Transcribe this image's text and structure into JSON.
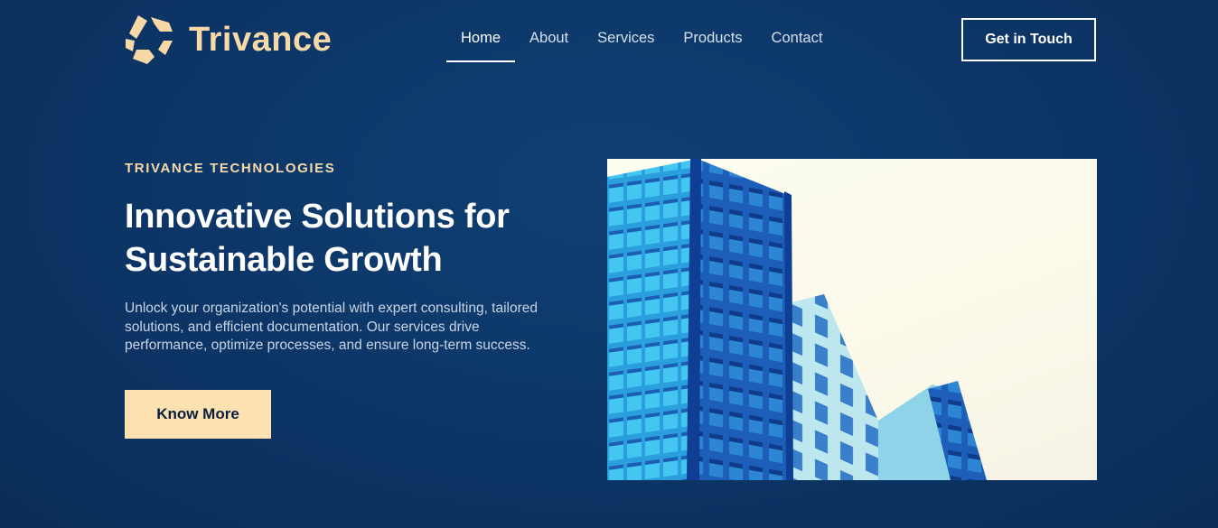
{
  "brand": {
    "name": "Trivance",
    "logo_icon": "trivance-logo-icon",
    "color": "#f7d9a8"
  },
  "nav": {
    "items": [
      {
        "label": "Home",
        "active": true
      },
      {
        "label": "About",
        "active": false
      },
      {
        "label": "Services",
        "active": false
      },
      {
        "label": "Products",
        "active": false
      },
      {
        "label": "Contact",
        "active": false
      }
    ],
    "cta_label": "Get in Touch"
  },
  "hero": {
    "eyebrow": "TRIVANCE TECHNOLOGIES",
    "headline_line1": "Innovative Solutions for",
    "headline_line2": "Sustainable Growth",
    "description": "Unlock your organization's potential with expert consulting, tailored solutions, and efficient documentation. Our services drive performance, optimize processes, and ensure long-term success.",
    "button_label": "Know More",
    "image_subject": "glass-office-building-photo"
  },
  "colors": {
    "background": "#0c3566",
    "accent": "#fde1b0",
    "text": "#ffffff",
    "muted_text": "#c8d4e6"
  }
}
